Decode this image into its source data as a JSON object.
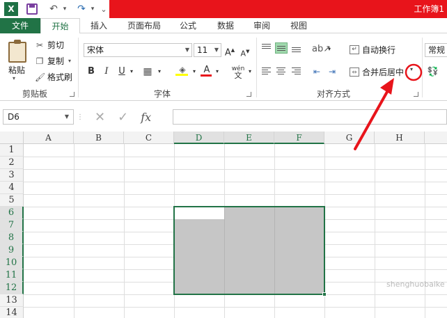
{
  "titlebar": {
    "app_logo": "X",
    "workbook_title": "工作簿1",
    "qat": {
      "undo_icon": "↶",
      "redo_icon": "↷",
      "more_icon": "⌄"
    },
    "accent_color": "#e8141b"
  },
  "tabs": [
    {
      "label": "文件"
    },
    {
      "label": "开始"
    },
    {
      "label": "插入"
    },
    {
      "label": "页面布局"
    },
    {
      "label": "公式"
    },
    {
      "label": "数据"
    },
    {
      "label": "审阅"
    },
    {
      "label": "视图"
    }
  ],
  "ribbon": {
    "clipboard": {
      "paste": "粘贴",
      "cut": "剪切",
      "copy": "复制",
      "format_painter": "格式刷",
      "group_label": "剪贴板"
    },
    "font": {
      "font_name": "宋体",
      "font_size": "11",
      "grow_label": "A",
      "shrink_label": "A",
      "bold": "B",
      "italic": "I",
      "underline": "U",
      "font_color_letter": "A",
      "phonetic": "wén",
      "group_label": "字体"
    },
    "alignment": {
      "wrap_text": "自动换行",
      "merge_center": "合并后居中",
      "group_label": "对齐方式"
    },
    "number": {
      "format": "常规"
    }
  },
  "formula_bar": {
    "name_box": "D6",
    "cancel_icon": "✕",
    "enter_icon": "✓",
    "fx_label": "fx",
    "formula": ""
  },
  "sheet": {
    "columns": [
      "A",
      "B",
      "C",
      "D",
      "E",
      "F",
      "G",
      "H"
    ],
    "rows": [
      "1",
      "2",
      "3",
      "4",
      "5",
      "6",
      "7",
      "8",
      "9",
      "10",
      "11",
      "12",
      "13",
      "14"
    ],
    "active_cell": "D6",
    "selection": "D6:F12"
  },
  "watermark": "shenghuobaike"
}
